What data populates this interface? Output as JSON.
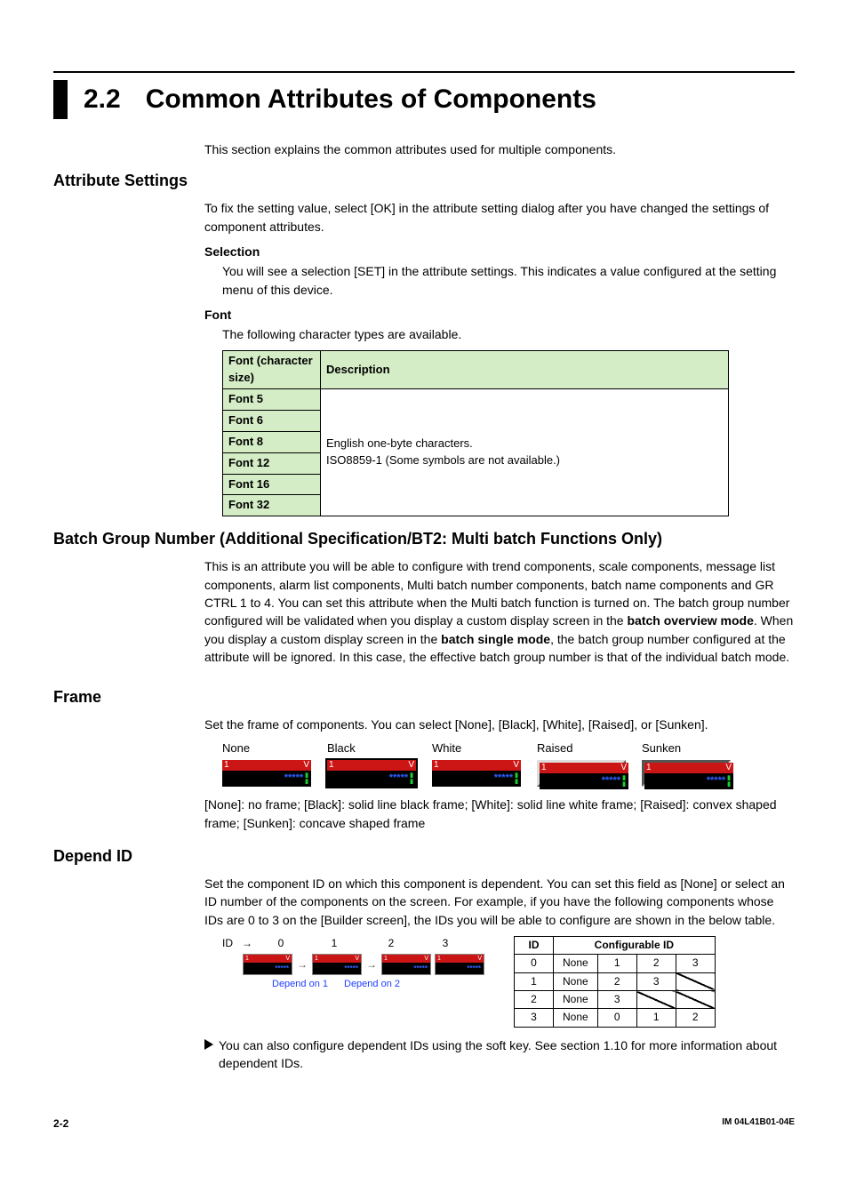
{
  "header": {
    "number": "2.2",
    "title": "Common Attributes of Components"
  },
  "intro": "This section explains the common attributes used for multiple components.",
  "attr": {
    "heading": "Attribute Settings",
    "text": "To fix the setting value, select [OK] in the attribute setting dialog after you have changed the settings of component attributes.",
    "selection": {
      "title": "Selection",
      "text": "You will see a selection [SET] in the attribute settings. This indicates a value configured at the setting menu of this device."
    },
    "font": {
      "title": "Font",
      "text": "The following character types are available.",
      "table": {
        "col1": "Font (character size)",
        "col2": "Description",
        "rows": [
          "Font 5",
          "Font 6",
          "Font 8",
          "Font 12",
          "Font 16",
          "Font 32"
        ],
        "desc_line1": "English one-byte characters.",
        "desc_line2": "ISO8859-1 (Some symbols are not available.)"
      }
    }
  },
  "batch": {
    "heading": "Batch Group Number (Additional Specification/BT2: Multi batch Functions Only)",
    "p1": "This is an attribute you will be able to configure with trend components, scale components, message list components, alarm list components, Multi batch number components, batch name components and GR CTRL 1 to 4. You can set this attribute when the Multi batch function is turned on. The batch group number configured will be validated when you display a custom display screen in the ",
    "bold1": "batch overview mode",
    "p2": ". When you display a custom display screen in the ",
    "bold2": "batch single mode",
    "p3": ", the batch group number configured at the attribute will be ignored. In this case, the effective batch group number is that of the individual batch mode."
  },
  "frame": {
    "heading": "Frame",
    "text": "Set the frame of components. You can select [None], [Black], [White], [Raised], or [Sunken].",
    "labels": [
      "None",
      "Black",
      "White",
      "Raised",
      "Sunken"
    ],
    "sample_num": "1",
    "sample_unit": "V",
    "sample_text": "*****",
    "desc": "[None]: no frame; [Black]: solid line black frame; [White]: solid line white frame; [Raised]: convex shaped frame; [Sunken]: concave shaped frame"
  },
  "depend": {
    "heading": "Depend ID",
    "text": "Set the component ID on which this component is dependent. You can set this field as [None] or select an ID number of the components on the screen. For example, if you have the following components whose IDs are 0 to 3 on the [Builder screen], the IDs you will be able to configure are shown in the below table.",
    "id_label": "ID",
    "ids": [
      "0",
      "1",
      "2",
      "3"
    ],
    "note1": "Depend on 1",
    "note2": "Depend on 2",
    "table": {
      "hdr_id": "ID",
      "hdr_conf": "Configurable ID",
      "rows": [
        {
          "id": "0",
          "c": [
            "None",
            "1",
            "2",
            "3"
          ],
          "slash": -1
        },
        {
          "id": "1",
          "c": [
            "None",
            "2",
            "3",
            ""
          ],
          "slash": 3
        },
        {
          "id": "2",
          "c": [
            "None",
            "3",
            "",
            ""
          ],
          "slash": 2
        },
        {
          "id": "3",
          "c": [
            "None",
            "0",
            "1",
            "2"
          ],
          "slash": -1
        }
      ]
    },
    "tri_note": "You can also configure dependent IDs using the soft key. See section 1.10 for more information about dependent IDs."
  },
  "footer": {
    "page": "2-2",
    "doc": "IM 04L41B01-04E"
  }
}
